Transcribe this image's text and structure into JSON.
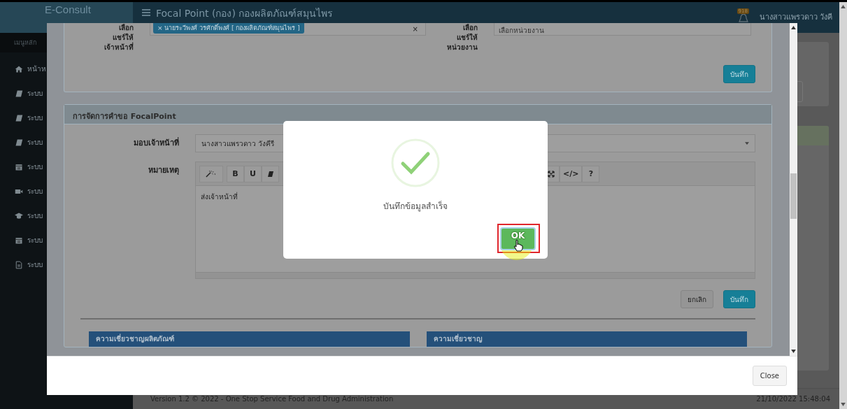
{
  "topbar": {
    "brand": "E-Consult",
    "page_title": "Focal Point (กอง) กองผลิตภัณฑ์สมุนไพร",
    "notification_count": "918",
    "user_name": "นางสาวแพรวดาว วังคี"
  },
  "sidebar": {
    "heading": "เมนูหลัก",
    "items": [
      {
        "kind": "home",
        "label": "หน้าห"
      },
      {
        "kind": "book",
        "label": "ระบบ"
      },
      {
        "kind": "book",
        "label": "ระบบ"
      },
      {
        "kind": "book",
        "label": "ระบบ"
      },
      {
        "kind": "calendar",
        "label": "ระบบ"
      },
      {
        "kind": "video",
        "label": "ระบบ"
      },
      {
        "kind": "cap",
        "label": "ระบบ"
      },
      {
        "kind": "calendar",
        "label": "ระบบ"
      },
      {
        "kind": "document",
        "label": "ระบบ"
      }
    ]
  },
  "footer": {
    "version": "Version 1.2 © 2022 - One Stop Service Food and Drug Administration",
    "timestamp": "21/10/2022 15:48:04"
  },
  "modal": {
    "share_panel": {
      "staff_label": "เลือก แชร์ให้ เจ้าหน้าที่",
      "staff_tags": [
        "× นายระวีพงศ์ วรศักดิ์พงศ์ [ กองผลิตภัณฑ์สมุนไพร ]"
      ],
      "clear": "×",
      "unit_label": "เลือก แชร์ให้ หน่วยงาน",
      "unit_placeholder": "เลือกหน่วยงาน",
      "save_button": "บันทึก"
    },
    "request_panel": {
      "title": "การจัดการคำขอ FocalPoint",
      "assign_label": "มอบเจ้าหน้าที่",
      "assign_value": "นางสาวแพรวดาว วังคีรี",
      "note_label": "หมายเหตุ",
      "toolbar_left": [
        {
          "kind": "magic"
        },
        {
          "kind": "text",
          "label": "B"
        },
        {
          "kind": "text",
          "label": "U"
        },
        {
          "kind": "eraser"
        }
      ],
      "toolbar_right": [
        {
          "kind": "expand"
        },
        {
          "kind": "text",
          "label": "</>"
        },
        {
          "kind": "text",
          "label": "?"
        }
      ],
      "note_text": "ส่งเจ้าหน้าที่",
      "cancel_button": "ยกเลิก",
      "save_button": "บันทึก"
    },
    "sections": [
      "ความเชี่ยวชาญผลิตภัณฑ์",
      "ความเชี่ยวชาญ"
    ],
    "close_button": "Close"
  },
  "alert": {
    "message": "บันทึกข้อมูลสำเร็จ",
    "ok_button": "OK"
  }
}
